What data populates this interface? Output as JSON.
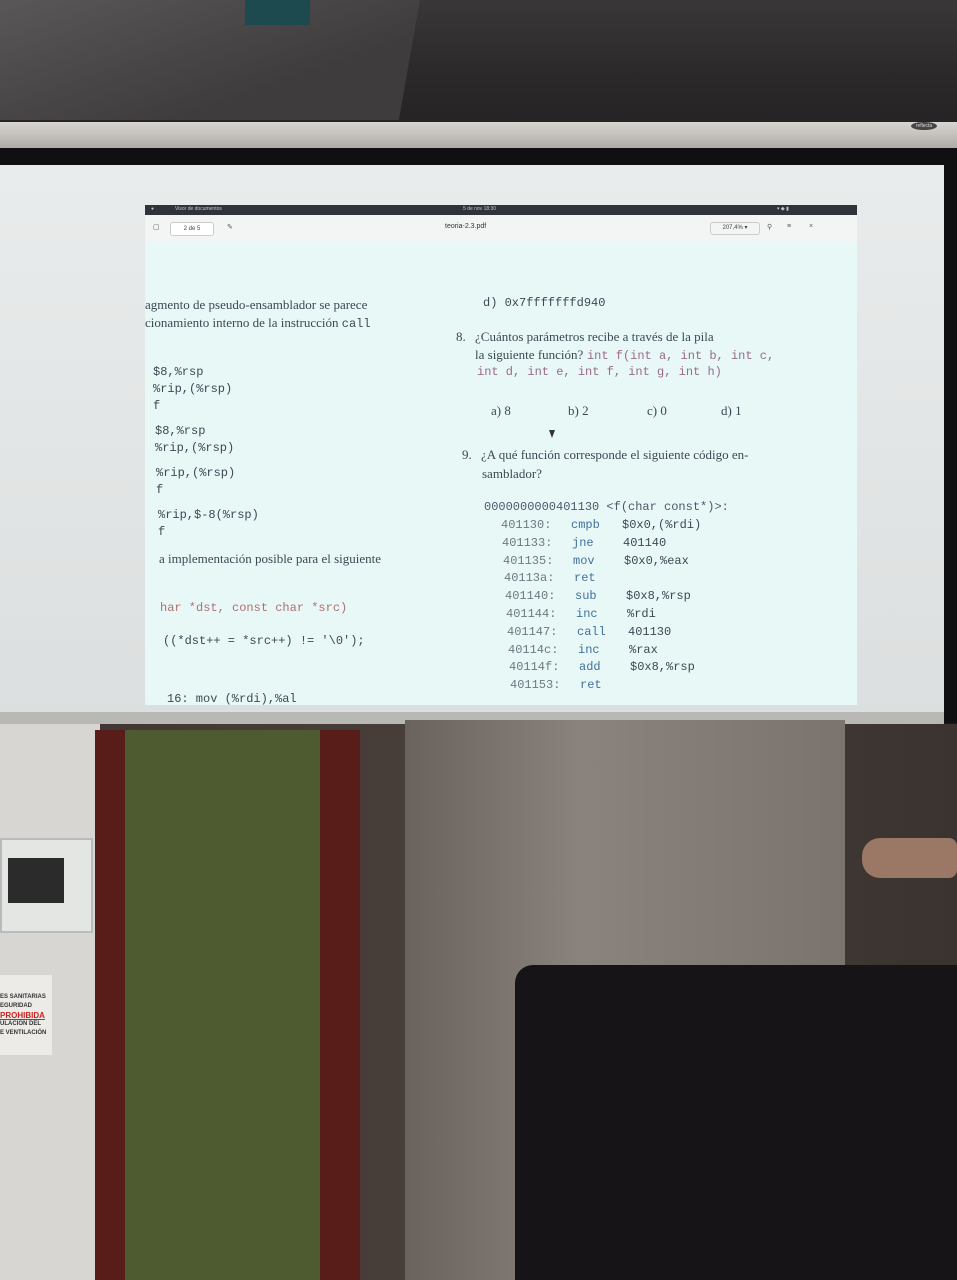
{
  "viewer": {
    "app_name": "Visor de documentos",
    "clock": "5 de nov 18:30",
    "page_indicator": "2 de 5",
    "doc_title": "teoria-2.3.pdf",
    "zoom": "207,4% ▾"
  },
  "left_col": {
    "line1": "agmento de pseudo-ensamblador se parece",
    "line2": "cionamiento interno de la instrucción",
    "line2_code": "call",
    "code_a": [
      "$8,%rsp",
      "%rip,(%rsp)",
      "f"
    ],
    "code_b": [
      "$8,%rsp",
      "%rip,(%rsp)"
    ],
    "code_c": [
      "%rip,(%rsp)",
      "f"
    ],
    "code_d": [
      "%rip,$-8(%rsp)",
      "f"
    ],
    "impl_text": "a implementación posible para el siguiente",
    "sig_text": "har *dst, const char *src)",
    "loop_text": "((*dst++ = *src++) != '\\0');",
    "bottom_line": "16:  mov     (%rdi),%al"
  },
  "right_col": {
    "answer_d": "d) 0x7fffffffd940",
    "q8_num": "8.",
    "q8_line1": "¿Cuántos parámetros recibe a través de la pila",
    "q8_line2": "la siguiente función?",
    "q8_code1": "int f(int a, int b, int c,",
    "q8_code2": "int d, int e, int f, int g, int h)",
    "q8_options": [
      "a) 8",
      "b) 2",
      "c) 0",
      "d) 1"
    ],
    "q9_num": "9.",
    "q9_line1": "¿A qué función corresponde el siguiente código en-",
    "q9_line2": "samblador?",
    "asm_header": "0000000000401130 <f(char const*)>:",
    "asm": [
      {
        "addr": "401130:",
        "op": "cmpb",
        "args": "$0x0,(%rdi)"
      },
      {
        "addr": "401133:",
        "op": "jne",
        "args": "401140"
      },
      {
        "addr": "401135:",
        "op": "mov",
        "args": "$0x0,%eax"
      },
      {
        "addr": "40113a:",
        "op": "ret",
        "args": ""
      },
      {
        "addr": "401140:",
        "op": "sub",
        "args": "$0x8,%rsp"
      },
      {
        "addr": "401144:",
        "op": "inc",
        "args": "%rdi"
      },
      {
        "addr": "401147:",
        "op": "call",
        "args": "401130"
      },
      {
        "addr": "40114c:",
        "op": "inc",
        "args": "%rax"
      },
      {
        "addr": "40114f:",
        "op": "add",
        "args": "$0x8,%rsp"
      },
      {
        "addr": "401153:",
        "op": "ret",
        "args": ""
      }
    ]
  },
  "room": {
    "projector_brand": "reflecta",
    "sign_lines": [
      "ES SANITARIAS",
      "EGURIDAD",
      "PROHIBIDA",
      "ULACIÓN DEL",
      "E VENTILACIÓN"
    ]
  }
}
